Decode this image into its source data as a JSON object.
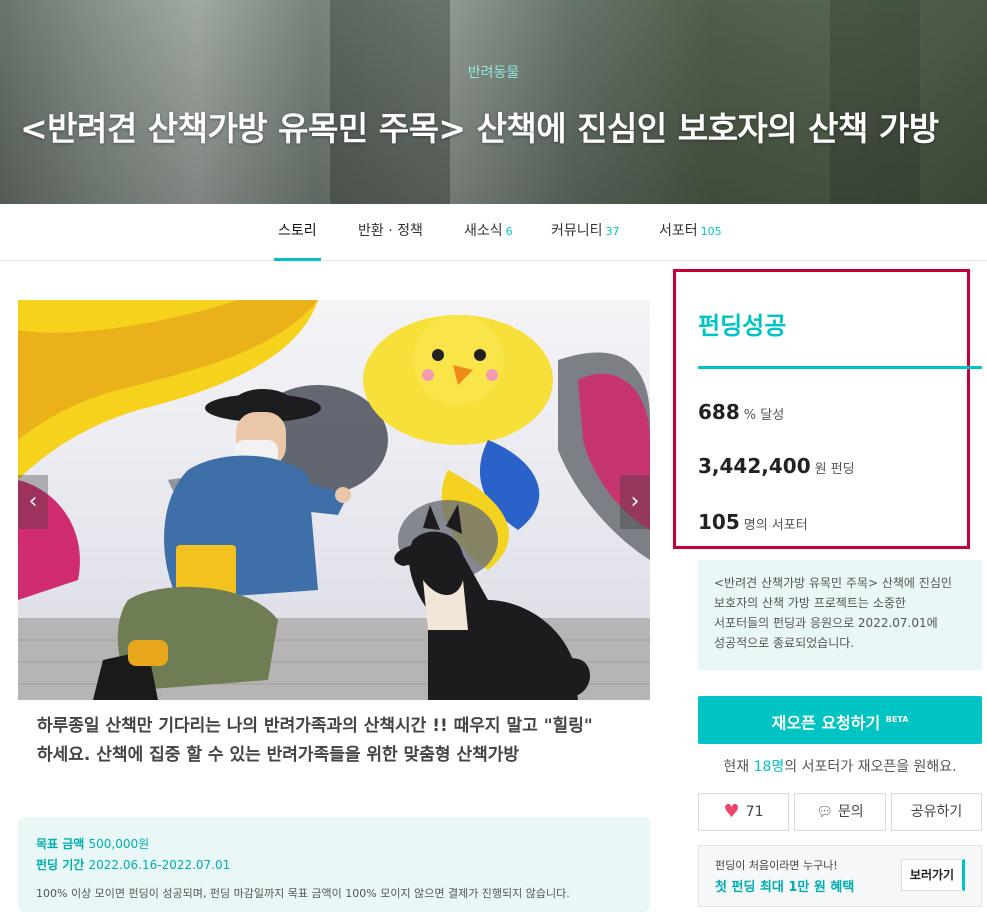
{
  "hero": {
    "category": "반려동물",
    "title": "<반려견 산책가방 유목민 주목> 산책에 진심인 보호자의 산책 가방"
  },
  "tabs": [
    {
      "label": "스토리",
      "count": ""
    },
    {
      "label": "반환 · 정책",
      "count": ""
    },
    {
      "label": "새소식",
      "count": "6"
    },
    {
      "label": "커뮤니티",
      "count": "37"
    },
    {
      "label": "서포터",
      "count": "105"
    }
  ],
  "carousel": {
    "prev": "‹",
    "next": "›"
  },
  "caption": {
    "line1": "하루종일 산책만 기다리는 나의 반려가족과의 산책시간 !! 때우지 말고 \"힐링\"",
    "line2": "하세요. 산책에 집중 할 수 있는 반려가족들을 위한 맞춤형 산책가방"
  },
  "goal": {
    "amount_label": "목표 금액",
    "amount_value": "500,000원",
    "period_label": "펀딩 기간",
    "period_value": "2022.06.16-2022.07.01",
    "note": "100% 이상 모이면 펀딩이 성공되며, 펀딩 마감일까지 목표 금액이 100% 모이지 않으면 결제가 진행되지 않습니다."
  },
  "status": {
    "title": "펀딩성공",
    "achievement": "688",
    "achievement_unit": "% 달성",
    "amount": "3,442,400",
    "amount_unit": "원 펀딩",
    "supporters": "105",
    "supporters_unit": "명의 서포터"
  },
  "info": {
    "line1": "<반려견 산책가방 유목민 주목> 산책에 진심인",
    "line2": "보호자의 산책 가방 프로젝트는 소중한",
    "line3": "서포터들의 펀딩과 응원으로 2022.07.01에",
    "line4": "성공적으로 종료되었습니다."
  },
  "reopen": {
    "label": "재오픈 요청하기",
    "badge": "BETA",
    "note_prefix": "현재",
    "note_count": "18명",
    "note_suffix": "의 서포터가 재오픈을 원해요."
  },
  "actions": {
    "like_count": "71",
    "inquiry": "문의",
    "share": "공유하기"
  },
  "promo": {
    "small": "펀딩이 처음이라면 누구나!",
    "big": "첫 펀딩 최대 1만 원 혜택",
    "button": "보러가기"
  },
  "colors": {
    "accent": "#00c4c4",
    "highlight_border": "#c8003a",
    "heart": "#f0466e"
  }
}
